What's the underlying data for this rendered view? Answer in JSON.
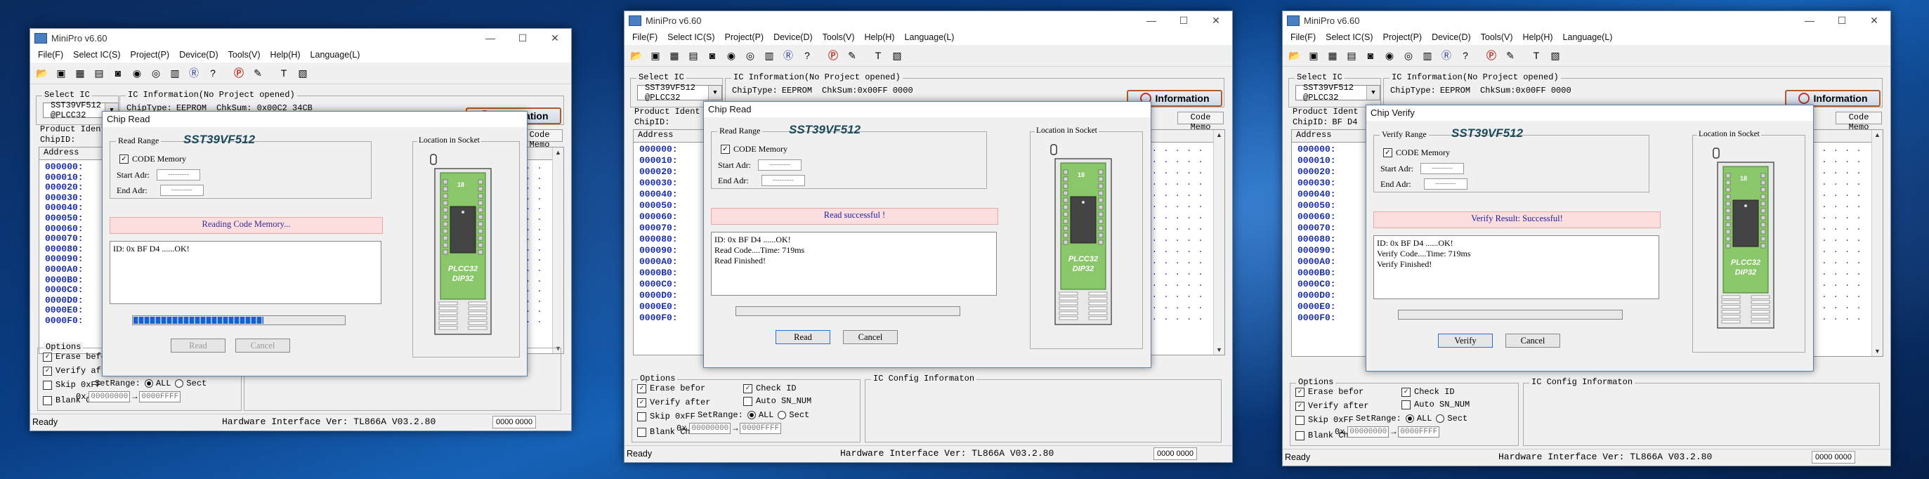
{
  "app": {
    "title": "MiniPro v6.60",
    "menu": [
      "File(F)",
      "Select IC(S)",
      "Project(P)",
      "Device(D)",
      "Tools(V)",
      "Help(H)",
      "Language(L)"
    ],
    "toolbar_icons": [
      "open-folder-icon",
      "save-icon",
      "chip-icon",
      "save-project-icon",
      "chip-read-icon",
      "chip-verify-icon",
      "chip-write-icon",
      "fill-icon",
      "chip-r-icon",
      "help-icon",
      "protect-p-icon",
      "edit-icon",
      "test-icon",
      "config-icon"
    ],
    "select_ic_label": "Select IC",
    "ic_info_label": "IC Information(No Project opened)",
    "chip_type_label": "ChipType:",
    "chip_type_value": "EEPROM",
    "information_btn": "Information",
    "product_ident_label": "Product Ident",
    "chip_id_label": "ChipID:",
    "address_head": "Address",
    "code_memo": "Code Memo",
    "addresses": [
      "000000:",
      "000010:",
      "000020:",
      "000030:",
      "000040:",
      "000050:",
      "000060:",
      "000070:",
      "000080:",
      "000090:",
      "0000A0:",
      "0000B0:",
      "0000C0:",
      "0000D0:",
      "0000E0:",
      "0000F0:"
    ],
    "dots": ". . . . . . .",
    "options_label": "Options",
    "opt_erase": "Erase befor",
    "opt_verify": "Verify after",
    "opt_skip": "Skip 0xFF",
    "opt_blank": "Blank Check",
    "opt_checkid": "Check ID",
    "opt_autosn": "Auto SN_NUM",
    "setrange_label": "SetRange:",
    "range_all": "ALL",
    "range_sect": "Sect",
    "range_prefix": "0x",
    "range_start": "00000000",
    "range_end": "0000FFFF",
    "ic_config_label": "IC Config Informaton",
    "status_ready": "Ready",
    "hw_version": "Hardware Interface Ver: TL866A V03.2.80",
    "counter": "0000 0000",
    "chip_name": "SST39VF512",
    "socket_label": "Location in Socket",
    "code_memory_label": "CODE Memory",
    "start_adr": "Start Adr:",
    "end_adr": "End Adr:",
    "adr_placeholder": "---------",
    "package1": "PLCC32",
    "package2": "DIP32",
    "pin18": "18"
  },
  "windows": [
    {
      "partial_ic": "SST39VF512 @PLCC32",
      "checksum": "ChkSum: 0x00C2 34CB",
      "chip_id_value": "",
      "dialog": {
        "title": "Chip Read",
        "range_label": "Read Range",
        "message": "Reading Code Memory...",
        "log": [
          "ID: 0x BF D4 ......OK!"
        ],
        "progress": 0.62,
        "btn_primary": "Read",
        "btn_cancel": "Cancel"
      }
    },
    {
      "partial_ic": "SST39VF512 @PLCC32",
      "checksum": "ChkSum:0x00FF 0000",
      "chip_id_value": "",
      "dialog": {
        "title": "Chip Read",
        "range_label": "Read Range",
        "message": "Read successful !",
        "log": [
          "ID: 0x BF D4 ......OK!",
          "Read Code....Time: 719ms",
          "Read Finished!"
        ],
        "progress": 0,
        "btn_primary": "Read",
        "btn_cancel": "Cancel"
      }
    },
    {
      "partial_ic": "SST39VF512 @PLCC32",
      "checksum": "ChkSum:0x00FF 0000",
      "chip_id_value": "BF D4",
      "dialog": {
        "title": "Chip Verify",
        "range_label": "Verify Range",
        "message": "Verify Result: Successful!",
        "log": [
          "ID: 0x BF D4 ......OK!",
          "Verify Code....Time: 719ms",
          "Verify Finished!"
        ],
        "progress": 0,
        "btn_primary": "Verify",
        "btn_cancel": "Cancel"
      }
    }
  ]
}
